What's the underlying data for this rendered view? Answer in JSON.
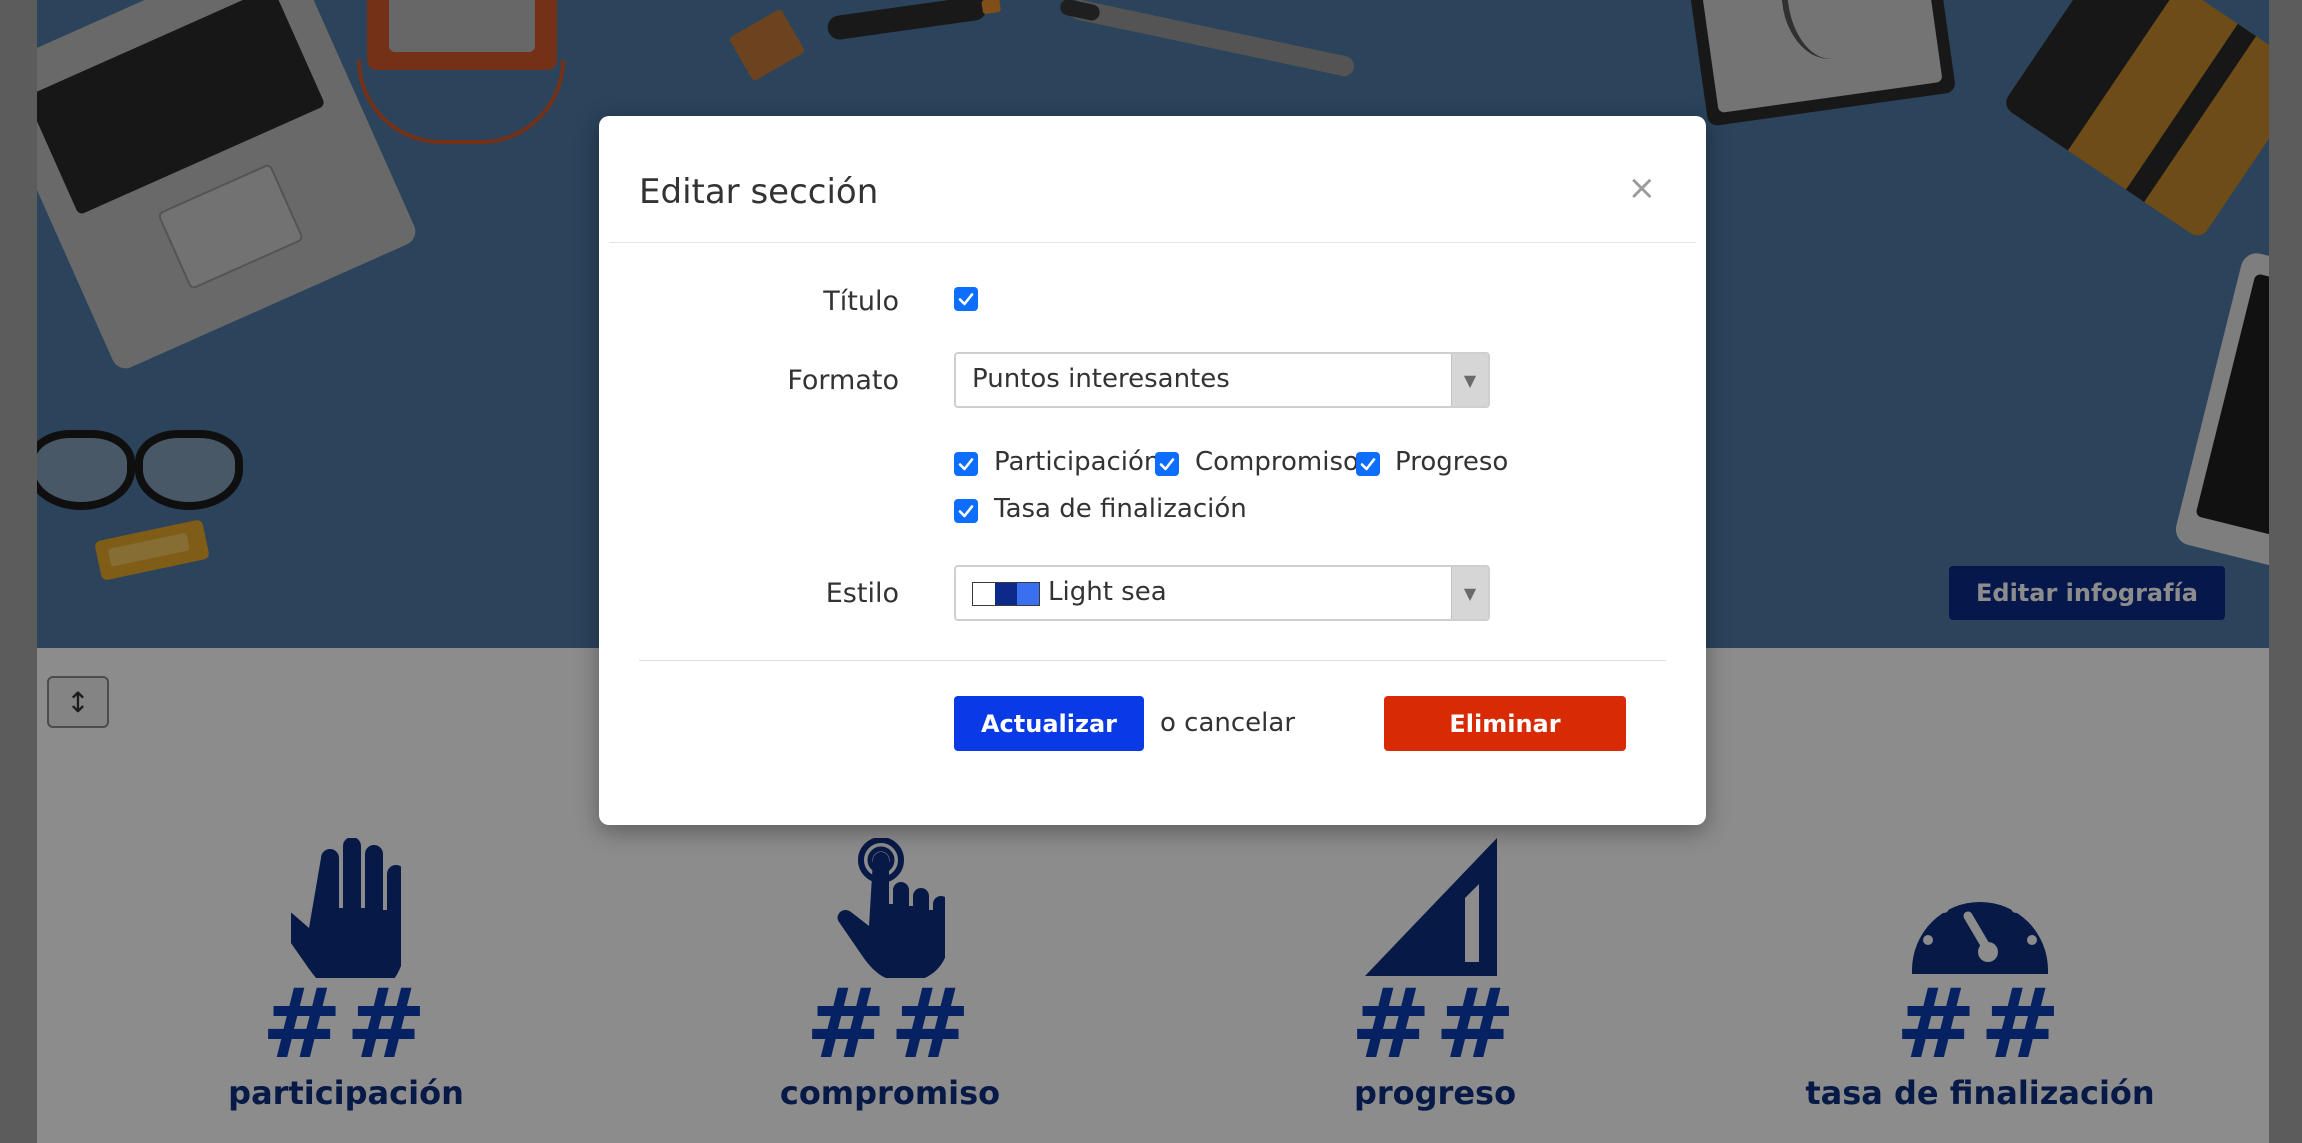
{
  "background": {
    "edit_infographic_label": "Editar infografía",
    "stats": [
      {
        "value": "##",
        "label": "participación",
        "icon": "raised-hand-icon"
      },
      {
        "value": "##",
        "label": "compromiso",
        "icon": "tap-finger-icon"
      },
      {
        "value": "##",
        "label": "progreso",
        "icon": "signal-ramp-icon"
      },
      {
        "value": "##",
        "label": "tasa de finalización",
        "icon": "gauge-icon"
      }
    ]
  },
  "modal": {
    "title": "Editar sección",
    "close_symbol": "×",
    "title_field_label": "Título",
    "title_checked": true,
    "format_label": "Formato",
    "format_value": "Puntos interesantes",
    "metrics": [
      {
        "label": "Participación",
        "checked": true
      },
      {
        "label": "Compromiso",
        "checked": true
      },
      {
        "label": "Progreso",
        "checked": true
      },
      {
        "label": "Tasa de finalización",
        "checked": true
      }
    ],
    "style_label": "Estilo",
    "style_value": "Light sea",
    "style_swatch_colors": [
      "#ffffff",
      "#0b2a8a",
      "#3a6ff0"
    ],
    "update_label": "Actualizar",
    "cancel_text": "o cancelar",
    "delete_label": "Eliminar"
  },
  "colors": {
    "primary": "#0a3ae6",
    "danger": "#d82a05",
    "navy": "#0b2b8a",
    "checkbox": "#0d6efd"
  }
}
